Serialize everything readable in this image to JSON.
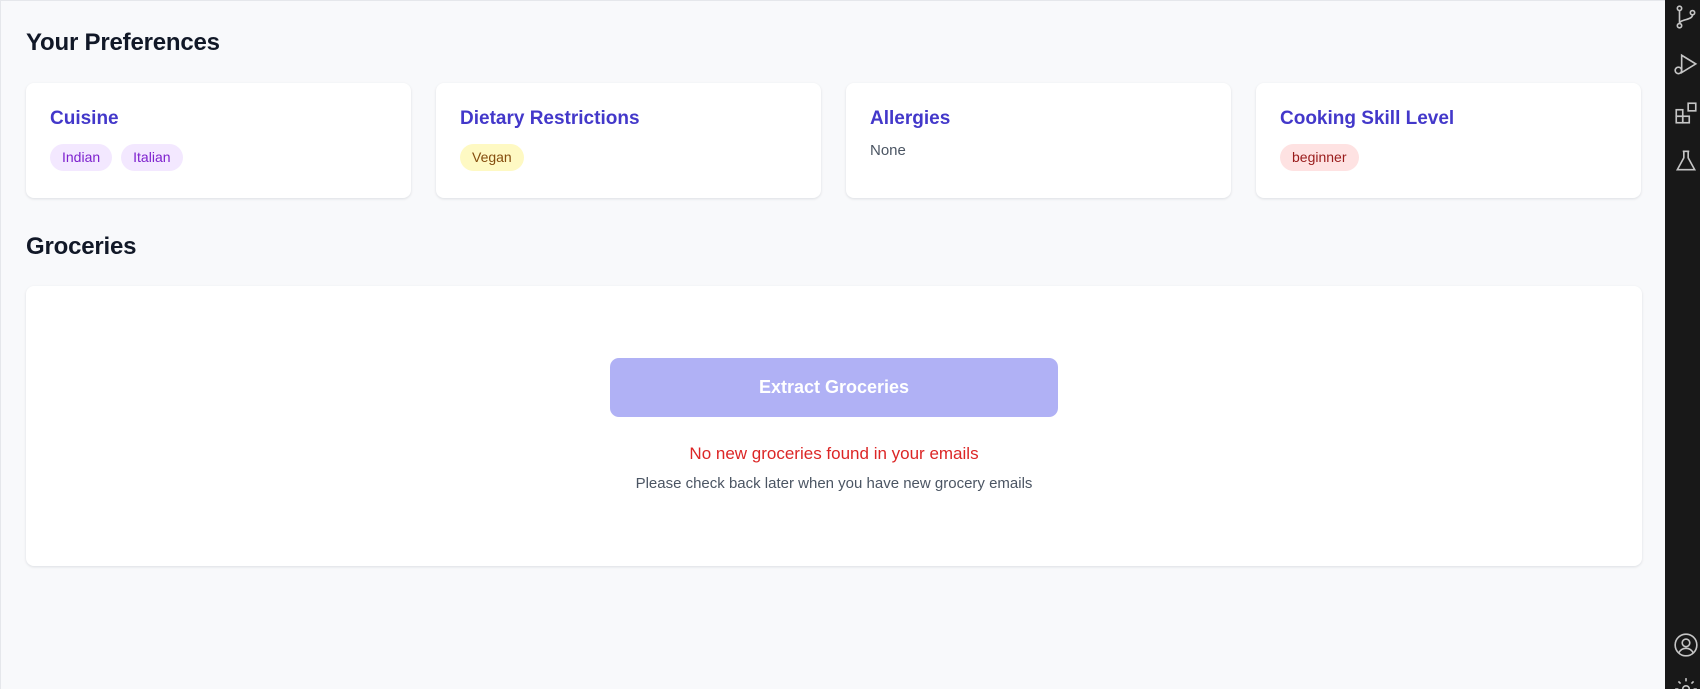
{
  "preferences": {
    "title": "Your Preferences",
    "cuisine": {
      "title": "Cuisine",
      "tags": [
        "Indian",
        "Italian"
      ]
    },
    "dietary": {
      "title": "Dietary Restrictions",
      "tags": [
        "Vegan"
      ]
    },
    "allergies": {
      "title": "Allergies",
      "value": "None"
    },
    "skill": {
      "title": "Cooking Skill Level",
      "tags": [
        "beginner"
      ]
    }
  },
  "groceries": {
    "title": "Groceries",
    "extract_button_label": "Extract Groceries",
    "empty_message": "No new groceries found in your emails",
    "empty_sub": "Please check back later when you have new grocery emails"
  },
  "activity_bar": {
    "icons": [
      "source-control-icon",
      "run-debug-icon",
      "extensions-icon",
      "testing-icon",
      "account-icon",
      "settings-gear-icon"
    ]
  },
  "colors": {
    "accent": "#4338ca",
    "button_disabled": "#b0b1f5",
    "error": "#dc2626",
    "tag_purple_bg": "#f3e8ff",
    "tag_yellow_bg": "#fef9c3",
    "tag_red_bg": "#fee2e2",
    "activity_bar": "#181818"
  }
}
